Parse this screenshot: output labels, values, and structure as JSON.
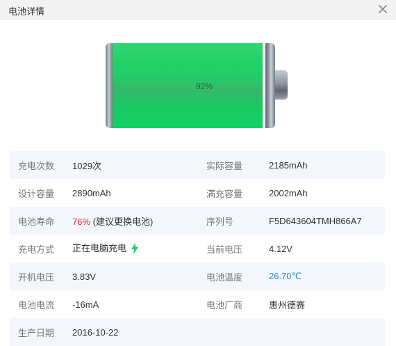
{
  "window": {
    "title": "电池详情"
  },
  "battery": {
    "charge_fraction": 0.92,
    "percent_label": "92%"
  },
  "details": [
    {
      "label": "充电次数",
      "value": "1029次",
      "label2": "实际容量",
      "value2": "2185mAh"
    },
    {
      "label": "设计容量",
      "value": "2890mAh",
      "label2": "满充容量",
      "value2": "2002mAh"
    },
    {
      "label": "电池寿命",
      "value": "76%",
      "value_suffix": " (建议更换电池)",
      "label2": "序列号",
      "value2": "F5D643604TMH866A7"
    },
    {
      "label": "充电方式",
      "value": "正在电脑充电",
      "label2": "当前电压",
      "value2": "4.12V"
    },
    {
      "label": "开机电压",
      "value": "3.83V",
      "label2": "电池温度",
      "value2": "26.70℃"
    },
    {
      "label": "电池电流",
      "value": "-16mA",
      "label2": "电池厂商",
      "value2": "惠州德赛"
    },
    {
      "label": "生产日期",
      "value": "2016-10-22",
      "label2": "",
      "value2": ""
    }
  ],
  "colors": {
    "health_warning": "#e02424",
    "temperature": "#2f87d8",
    "battery_fill": "#1fcf65"
  },
  "icons": {
    "close": "close-icon",
    "charging": "lightning-bolt-icon"
  }
}
